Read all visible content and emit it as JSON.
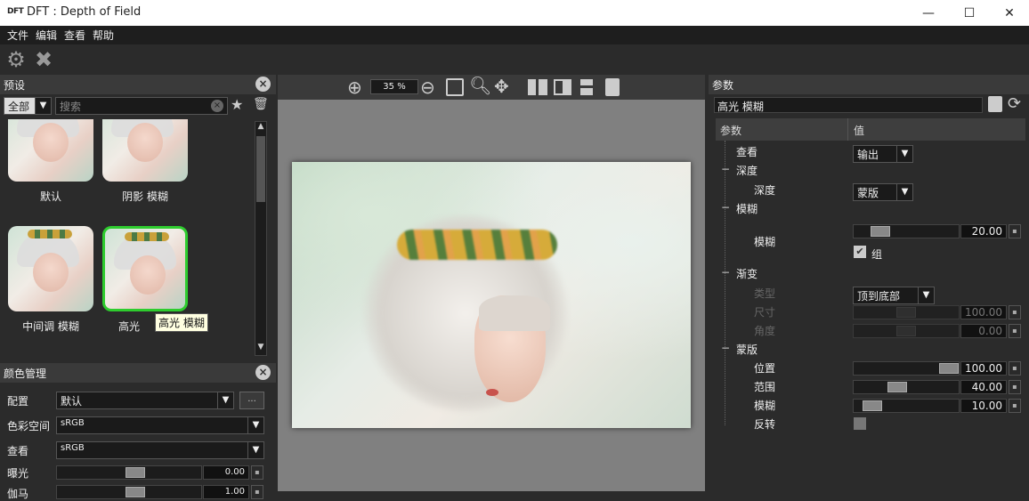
{
  "window": {
    "logo": "DFT",
    "title": "DFT : Depth of Field",
    "min": "—",
    "max": "☐",
    "close": "✕"
  },
  "menu": [
    "文件",
    "编辑",
    "查看",
    "帮助"
  ],
  "presets_panel": {
    "title": "预设",
    "filter": "全部",
    "search_placeholder": "搜索",
    "items": [
      {
        "label": "默认",
        "selected": false
      },
      {
        "label": "阴影 模糊",
        "selected": false
      },
      {
        "label": "中间调 模糊",
        "selected": false
      },
      {
        "label": "高光 模糊",
        "selected": true,
        "partial_label": "高光"
      }
    ],
    "tooltip": "高光 模糊"
  },
  "viewer": {
    "zoom": "35 %"
  },
  "color_panel": {
    "title": "颜色管理",
    "rows": [
      {
        "label": "配置",
        "value": "默认",
        "button": "..."
      },
      {
        "label": "色彩空间",
        "value": "sRGB"
      },
      {
        "label": "查看",
        "value": "sRGB"
      },
      {
        "label": "曝光",
        "value": "0.00",
        "level": 0.55
      },
      {
        "label": "伽马",
        "value": "1.00",
        "level": 0.55
      }
    ]
  },
  "params_panel": {
    "title": "参数",
    "preset_name": "高光 模糊",
    "col_param": "参数",
    "col_value": "值",
    "view_label": "查看",
    "view_value": "输出",
    "depth_section": "深度",
    "depth_label": "深度",
    "depth_value": "蒙版",
    "blur_section": "模糊",
    "blur_label": "模糊",
    "blur_value": "20.00",
    "blur_level": 0.2,
    "group_label": "组",
    "gradient_section": "渐变",
    "type_label": "类型",
    "type_value": "顶到底部",
    "size_label": "尺寸",
    "size_value": "100.00",
    "size_level": 0.5,
    "angle_label": "角度",
    "angle_value": "0.00",
    "angle_level": 0.5,
    "mask_section": "蒙版",
    "pos_label": "位置",
    "pos_value": "100.00",
    "pos_level": 1.0,
    "range_label": "范围",
    "range_value": "40.00",
    "range_level": 0.4,
    "mblur_label": "模糊",
    "mblur_value": "10.00",
    "mblur_level": 0.1,
    "invert_label": "反转"
  }
}
